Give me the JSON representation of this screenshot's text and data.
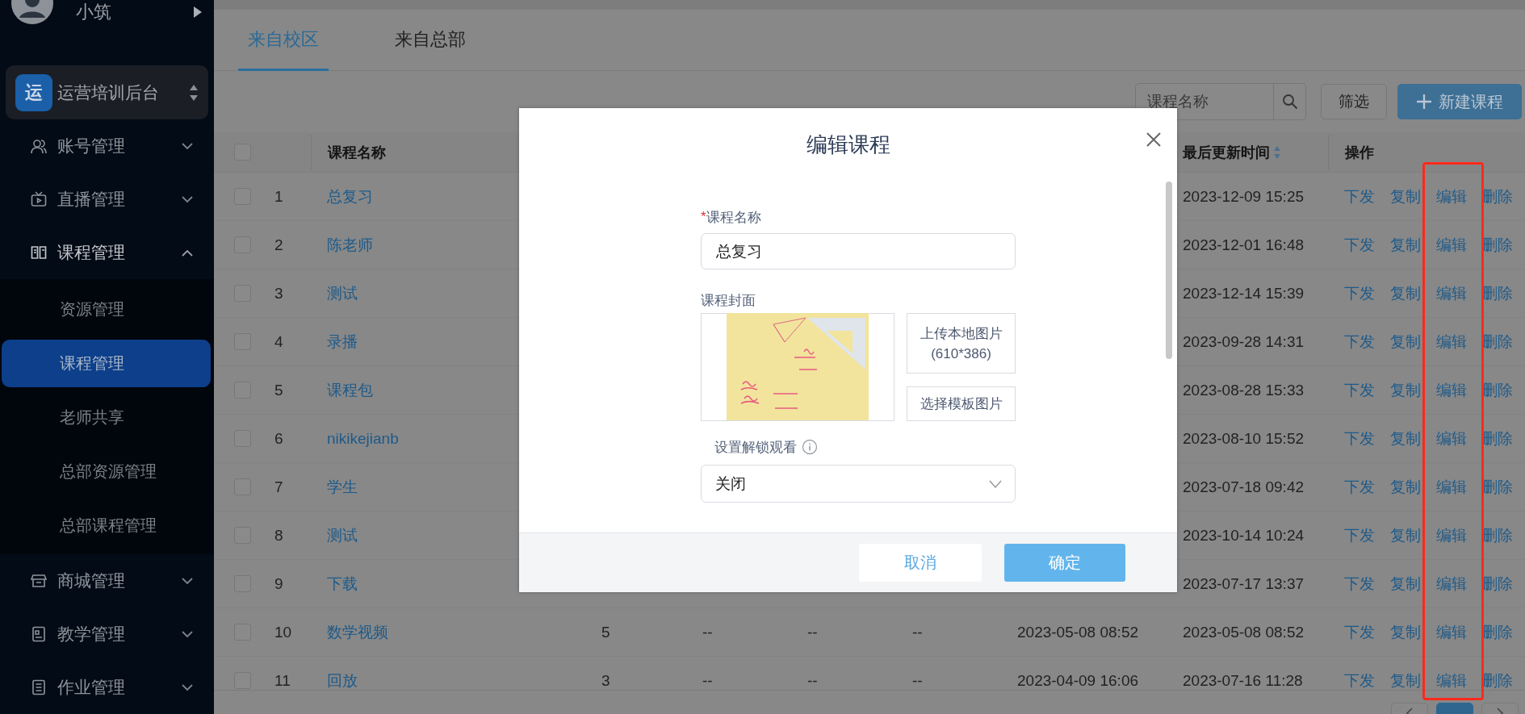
{
  "sidebar": {
    "user": {
      "name": "小筑"
    },
    "platform": {
      "badge": "运",
      "name": "运营培训后台"
    },
    "menu": [
      {
        "label": "账号管理",
        "expanded": false
      },
      {
        "label": "直播管理",
        "expanded": false
      },
      {
        "label": "课程管理",
        "expanded": true,
        "children": [
          {
            "label": "资源管理",
            "selected": false
          },
          {
            "label": "课程管理",
            "selected": true
          },
          {
            "label": "老师共享",
            "selected": false
          },
          {
            "label": "总部资源管理",
            "selected": false
          },
          {
            "label": "总部课程管理",
            "selected": false
          }
        ]
      },
      {
        "label": "商城管理",
        "expanded": false
      },
      {
        "label": "教学管理",
        "expanded": false
      },
      {
        "label": "作业管理",
        "expanded": false
      }
    ]
  },
  "tabs": [
    {
      "label": "来自校区",
      "selected": true
    },
    {
      "label": "来自总部",
      "selected": false
    }
  ],
  "toolbar": {
    "search": {
      "placeholder": "课程名称"
    },
    "filter_button": "筛选",
    "create_button": "新建课程"
  },
  "table": {
    "select_all": {
      "checked": false
    },
    "header": {
      "name": "课程名称",
      "column_9": "最后更新时间",
      "actions": "操作"
    },
    "rows": [
      {
        "checked": false,
        "index": "1",
        "name": "总复习",
        "column_9": "2023-12-09 15:25",
        "actions": [
          "下发",
          "复制",
          "编辑",
          "删除"
        ]
      },
      {
        "checked": false,
        "index": "2",
        "name": "陈老师",
        "column_9": "2023-12-01 16:48",
        "actions": [
          "下发",
          "复制",
          "编辑",
          "删除"
        ]
      },
      {
        "checked": false,
        "index": "3",
        "name": "测试",
        "column_9": "2023-12-14 15:39",
        "actions": [
          "下发",
          "复制",
          "编辑",
          "删除"
        ]
      },
      {
        "checked": false,
        "index": "4",
        "name": "录播",
        "column_9": "2023-09-28 14:31",
        "actions": [
          "下发",
          "复制",
          "编辑",
          "删除"
        ]
      },
      {
        "checked": false,
        "index": "5",
        "name": "课程包",
        "column_9": "2023-08-28 15:33",
        "actions": [
          "下发",
          "复制",
          "编辑",
          "删除"
        ]
      },
      {
        "checked": false,
        "index": "6",
        "name": "nikikejianb",
        "column_9": "2023-08-10 15:52",
        "actions": [
          "下发",
          "复制",
          "编辑",
          "删除"
        ]
      },
      {
        "checked": false,
        "index": "7",
        "name": "学生",
        "column_9": "2023-07-18 09:42",
        "actions": [
          "下发",
          "复制",
          "编辑",
          "删除"
        ]
      },
      {
        "checked": false,
        "index": "8",
        "name": "测试",
        "column_9": "2023-10-14 10:24",
        "actions": [
          "下发",
          "复制",
          "编辑",
          "删除"
        ]
      },
      {
        "checked": false,
        "index": "9",
        "name": "下载",
        "column_9": "2023-07-17 13:37",
        "actions": [
          "下发",
          "复制",
          "编辑",
          "删除"
        ]
      },
      {
        "checked": false,
        "index": "10",
        "name": "数学视频",
        "column_4": "5",
        "column_5": "--",
        "column_6": "--",
        "column_7": "--",
        "column_8": "2023-05-08 08:52",
        "column_9": "2023-05-08 08:52",
        "actions": [
          "下发",
          "复制",
          "编辑",
          "删除"
        ]
      },
      {
        "checked": false,
        "index": "11",
        "name": "回放",
        "column_4": "3",
        "column_5": "--",
        "column_6": "--",
        "column_7": "--",
        "column_8": "2023-04-09 16:06",
        "column_9": "2023-07-16 11:28",
        "actions": [
          "下发",
          "复制",
          "编辑",
          "删除"
        ]
      }
    ]
  },
  "pagination": [
    {
      "kind": "prev",
      "selected": false
    },
    {
      "kind": "page",
      "selected": true
    },
    {
      "kind": "next",
      "selected": false
    }
  ],
  "modal": {
    "title": "编辑课程",
    "name_field": {
      "required_mark": "*",
      "label": "课程名称",
      "value": "总复习"
    },
    "cover": {
      "label": "课程封面",
      "upload_button": "上传本地图片",
      "upload_hint": "(610*386)",
      "template_button": "选择模板图片"
    },
    "unlock": {
      "label": "设置解锁观看",
      "value": "关闭"
    },
    "buttons": {
      "cancel": "取消",
      "confirm": "确定"
    }
  }
}
